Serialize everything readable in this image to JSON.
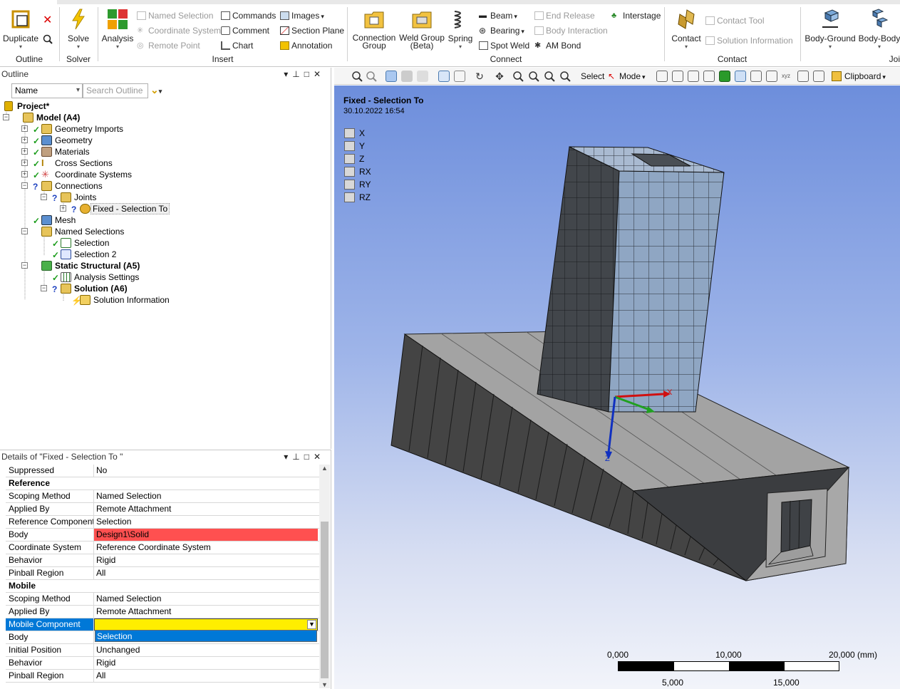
{
  "ribbon": {
    "outline_group": {
      "label": "Outline",
      "duplicate": "Duplicate"
    },
    "solve_group": {
      "label": "Solver",
      "solve": "Solve"
    },
    "insert_group": {
      "label": "Insert",
      "analysis": "Analysis",
      "named_selection": "Named Selection",
      "coordinate_system": "Coordinate System",
      "remote_point": "Remote Point",
      "commands": "Commands",
      "comment": "Comment",
      "chart": "Chart",
      "images": "Images",
      "section_plane": "Section Plane",
      "annotation": "Annotation"
    },
    "connect_group": {
      "label": "Connect",
      "connection_group": "Connection Group",
      "weld_group": "Weld Group (Beta)",
      "spring": "Spring",
      "beam": "Beam",
      "bearing": "Bearing",
      "spot_weld": "Spot Weld",
      "end_release": "End Release",
      "body_interaction": "Body Interaction",
      "am_bond": "AM Bond",
      "interstage": "Interstage"
    },
    "contact_group": {
      "label": "Contact",
      "contact": "Contact",
      "contact_tool": "Contact Tool",
      "solution_information": "Solution Information"
    },
    "joint_group": {
      "label": "Joi",
      "body_ground": "Body-Ground",
      "body_body": "Body-Body"
    }
  },
  "outline": {
    "title": "Outline",
    "name_filter": "Name",
    "search_placeholder": "Search Outline",
    "tree": {
      "project": "Project*",
      "model": "Model (A4)",
      "geometry_imports": "Geometry Imports",
      "geometry": "Geometry",
      "materials": "Materials",
      "cross_sections": "Cross Sections",
      "coordinate_systems": "Coordinate Systems",
      "connections": "Connections",
      "joints": "Joints",
      "fixed": "Fixed - Selection To",
      "mesh": "Mesh",
      "named_selections": "Named Selections",
      "selection": "Selection",
      "selection2": "Selection 2",
      "static_structural": "Static Structural (A5)",
      "analysis_settings": "Analysis Settings",
      "solution": "Solution (A6)",
      "solution_information": "Solution Information"
    }
  },
  "details": {
    "title": "Details of \"Fixed - Selection To \"",
    "rows": [
      {
        "k": "Suppressed",
        "v": "No"
      },
      {
        "k": "Reference",
        "v": ""
      },
      {
        "k": "Scoping Method",
        "v": "Named Selection"
      },
      {
        "k": "Applied By",
        "v": "Remote Attachment"
      },
      {
        "k": "Reference Component",
        "v": "Selection"
      },
      {
        "k": "Body",
        "v": "Design1\\Solid"
      },
      {
        "k": "Coordinate System",
        "v": "Reference Coordinate System"
      },
      {
        "k": "Behavior",
        "v": "Rigid"
      },
      {
        "k": "Pinball Region",
        "v": "All"
      },
      {
        "k": "Mobile",
        "v": ""
      },
      {
        "k": "Scoping Method",
        "v": "Named Selection"
      },
      {
        "k": "Applied By",
        "v": "Remote Attachment"
      },
      {
        "k": "Mobile Component",
        "v": ""
      },
      {
        "k": "Body",
        "v": ""
      },
      {
        "k": "Initial Position",
        "v": "Unchanged"
      },
      {
        "k": "Behavior",
        "v": "Rigid"
      },
      {
        "k": "Pinball Region",
        "v": "All"
      }
    ],
    "dropdown_option": "Selection"
  },
  "graphics_toolbar": {
    "select": "Select",
    "mode": "Mode",
    "clipboard": "Clipboard"
  },
  "viewport": {
    "title": "Fixed - Selection To",
    "date": "30.10.2022 16:54",
    "dofs": [
      "X",
      "Y",
      "Z",
      "RX",
      "RY",
      "RZ"
    ],
    "triad": {
      "x": "X",
      "z": "Z"
    },
    "scale": {
      "t0": "0,000",
      "t10": "10,000",
      "t20": "20,000 (mm)",
      "t5": "5,000",
      "t15": "15,000"
    }
  },
  "colors": {
    "accent": "#0078d7",
    "invalid_field": "#ff5050",
    "required_field": "#ffee00",
    "mesh_light": "#8fa6c3",
    "mesh_dark": "#404448"
  }
}
